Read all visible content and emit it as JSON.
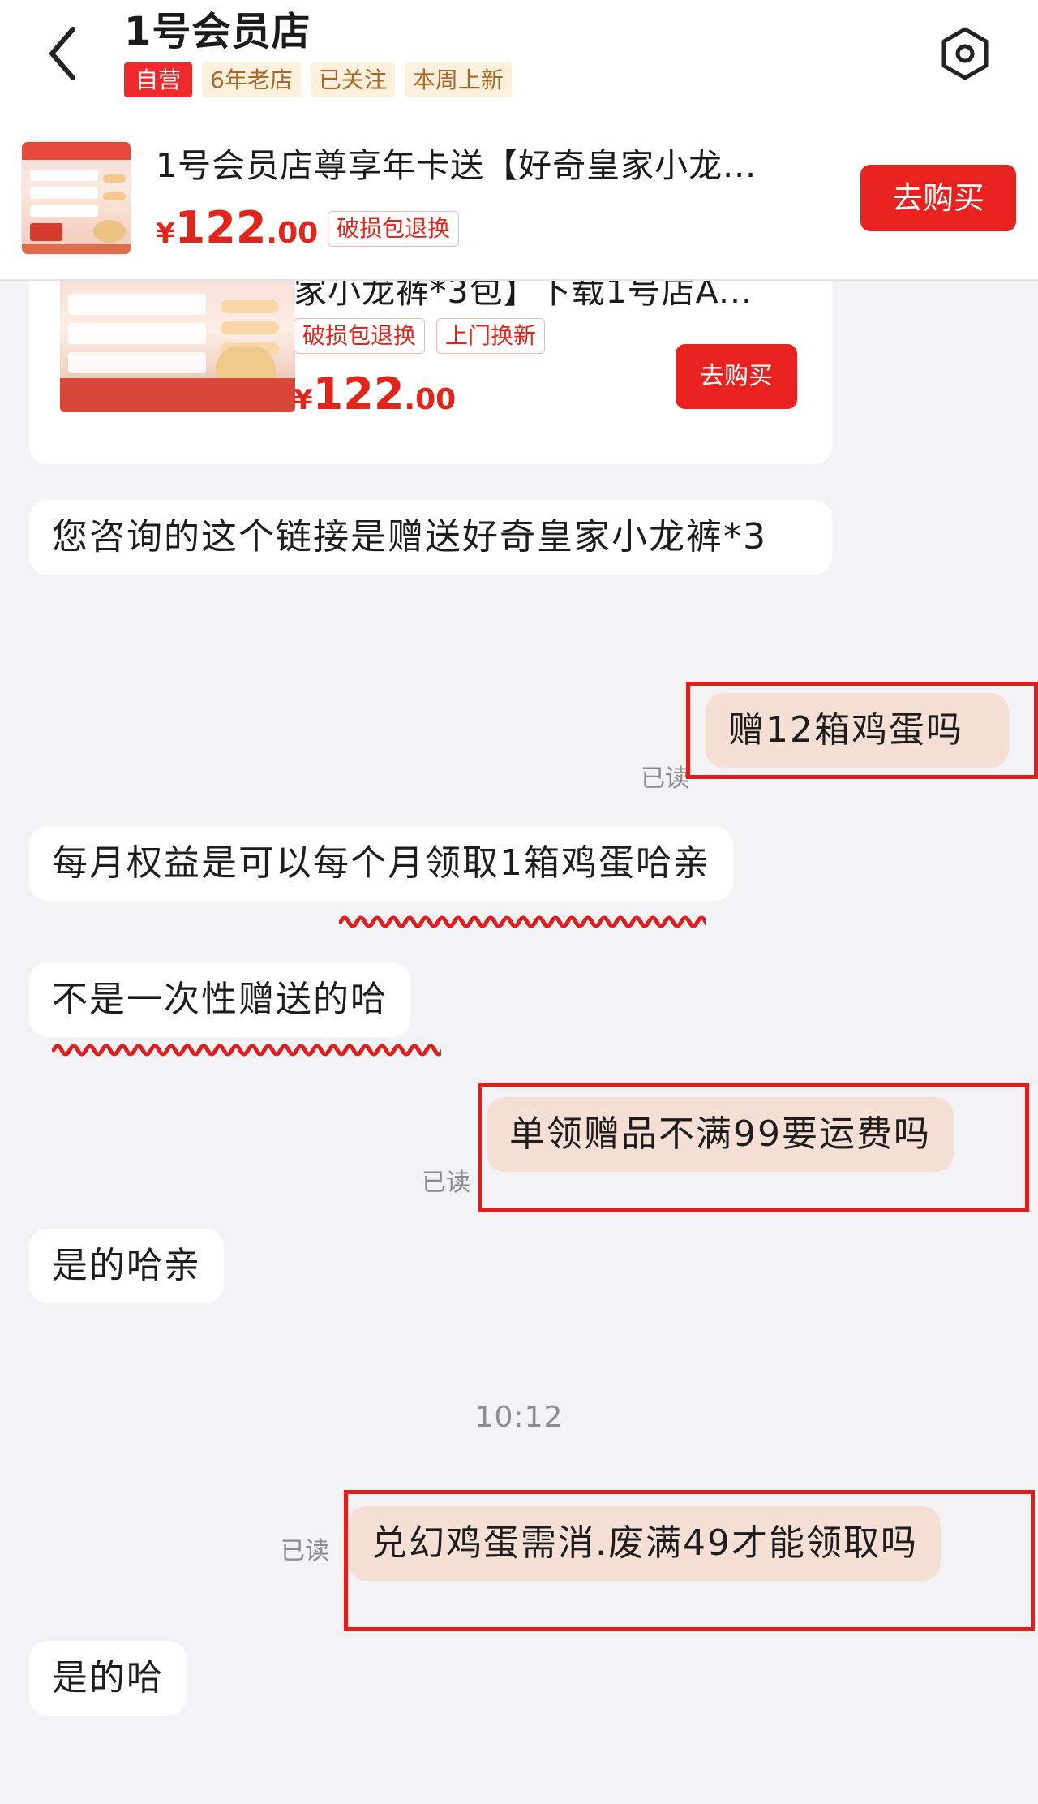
{
  "header": {
    "shop_name": "1号会员店",
    "tags": [
      "自营",
      "6年老店",
      "已关注",
      "本周上新"
    ]
  },
  "product_bar": {
    "title": "1号会员店尊享年卡送【好奇皇家小龙...",
    "price_symbol": "¥",
    "price_int": "122",
    "price_dec": ".00",
    "badge": "破损包退换",
    "buy_label": "去购买"
  },
  "card": {
    "title": "家小龙裤*3包】下载1号店A...",
    "badges": [
      "破损包退换",
      "上门换新"
    ],
    "price_symbol": "¥",
    "price_int": "122",
    "price_dec": ".00",
    "buy_label": "去购买"
  },
  "messages": [
    {
      "side": "left",
      "text": "您咨询的这个链接是赠送好奇皇家小龙裤*3"
    },
    {
      "side": "right",
      "text": "赠12箱鸡蛋吗",
      "status": "已读"
    },
    {
      "side": "left",
      "text": "每月权益是可以每个月领取1箱鸡蛋哈亲"
    },
    {
      "side": "left",
      "text": "不是一次性赠送的哈"
    },
    {
      "side": "right",
      "text": "单领赠品不满99要运费吗",
      "status": "已读"
    },
    {
      "side": "left",
      "text": "是的哈亲"
    },
    {
      "side": "right",
      "text": "兑幻鸡蛋需消.废满49才能领取吗",
      "status": "已读"
    },
    {
      "side": "left",
      "text": "是的哈"
    }
  ],
  "timestamp": "10:12",
  "colors": {
    "accent_red": "#e8231f",
    "bubble_right": "#f6e0d6",
    "bubble_left": "#ffffff",
    "background": "#f3f3f5",
    "annotation": "#e11d1d"
  },
  "icons": [
    "back-arrow-icon",
    "settings-hexagon-icon"
  ]
}
